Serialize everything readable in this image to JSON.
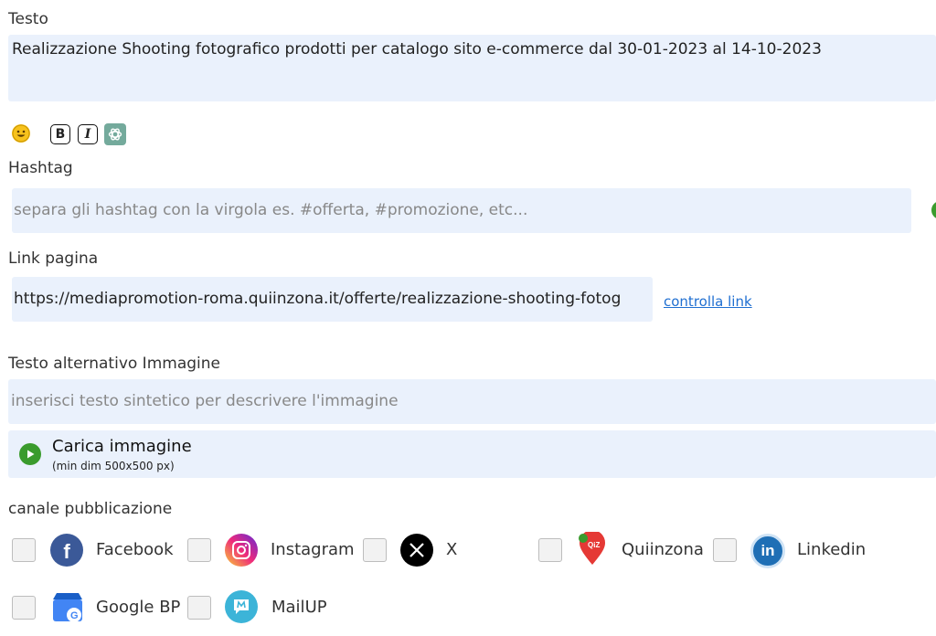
{
  "testo": {
    "label": "Testo",
    "value": "Realizzazione Shooting fotografico prodotti per catalogo sito e-commerce dal 30-01-2023 al 14-10-2023"
  },
  "toolbar": {
    "bold_label": "B",
    "italic_label": "I"
  },
  "hashtag": {
    "label": "Hashtag",
    "placeholder": "separa gli hashtag con la virgola es. #offerta, #promozione, etc..."
  },
  "link_pagina": {
    "label": "Link pagina",
    "value": "https://mediapromotion-roma.quiinzona.it/offerte/realizzazione-shooting-fotog",
    "check_link": "controlla link"
  },
  "alt_text": {
    "label": "Testo alternativo Immagine",
    "placeholder": "inserisci testo sintetico per descrivere l'immagine"
  },
  "upload": {
    "title": "Carica immagine",
    "subtitle": "(min dim 500x500 px)"
  },
  "canale": {
    "label": "canale pubblicazione",
    "channels": [
      {
        "name": "Facebook",
        "icon": "facebook-icon",
        "color": "#3b5998"
      },
      {
        "name": "Instagram",
        "icon": "instagram-icon",
        "color": "#e1306c"
      },
      {
        "name": "X",
        "icon": "x-icon",
        "color": "#000000"
      },
      {
        "name": "Quiinzona",
        "icon": "quiinzona-icon",
        "color": "#e53935"
      },
      {
        "name": "Linkedin",
        "icon": "linkedin-icon",
        "color": "#1f6fb5"
      },
      {
        "name": "Google BP",
        "icon": "google-bp-icon",
        "color": "#4285f4"
      },
      {
        "name": "MailUP",
        "icon": "mailup-icon",
        "color": "#3cb4d8"
      }
    ]
  },
  "colors": {
    "field_bg": "#eaf1fc",
    "link": "#1f6fd1",
    "upload_green": "#3a9b2d"
  }
}
